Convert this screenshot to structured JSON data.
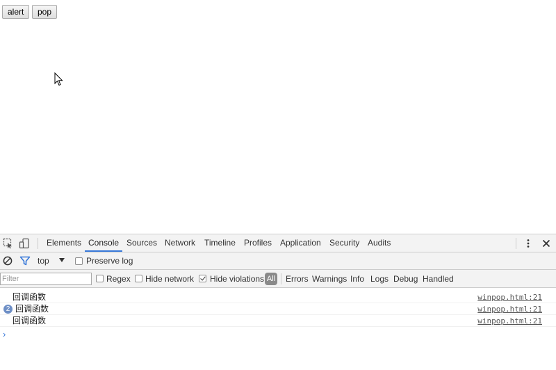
{
  "page": {
    "buttons": [
      {
        "label": "alert"
      },
      {
        "label": "pop"
      }
    ]
  },
  "devtools": {
    "tabs": [
      {
        "label": "Elements",
        "active": false
      },
      {
        "label": "Console",
        "active": true
      },
      {
        "label": "Sources",
        "active": false
      },
      {
        "label": "Network",
        "active": false
      },
      {
        "label": "Timeline",
        "active": false
      },
      {
        "label": "Profiles",
        "active": false
      },
      {
        "label": "Application",
        "active": false
      },
      {
        "label": "Security",
        "active": false
      },
      {
        "label": "Audits",
        "active": false
      }
    ],
    "context_select": "top",
    "preserve_log": {
      "label": "Preserve log",
      "checked": false
    },
    "filter": {
      "placeholder": "Filter"
    },
    "regex": {
      "label": "Regex",
      "checked": false
    },
    "hide_network": {
      "label": "Hide network",
      "checked": false
    },
    "hide_violations": {
      "label": "Hide violations",
      "checked": true
    },
    "levels": {
      "all": "All",
      "errors": "Errors",
      "warnings": "Warnings",
      "info": "Info",
      "logs": "Logs",
      "debug": "Debug",
      "handled": "Handled"
    },
    "messages": [
      {
        "text": "回调函数",
        "source": "winpop.html:21",
        "repeat": null
      },
      {
        "text": "回调函数",
        "source": "winpop.html:21",
        "repeat": "2"
      },
      {
        "text": "回调函数",
        "source": "winpop.html:21",
        "repeat": null
      }
    ],
    "prompt": "›",
    "colors": {
      "accent": "#3879d9",
      "toolbar_bg": "#f3f3f3",
      "badge": "#6e8fc6"
    },
    "icons": [
      "inspect-icon",
      "device-toggle-icon",
      "more-vert-icon",
      "close-icon",
      "clear-console-icon",
      "filter-icon",
      "dropdown-arrow-icon"
    ]
  }
}
